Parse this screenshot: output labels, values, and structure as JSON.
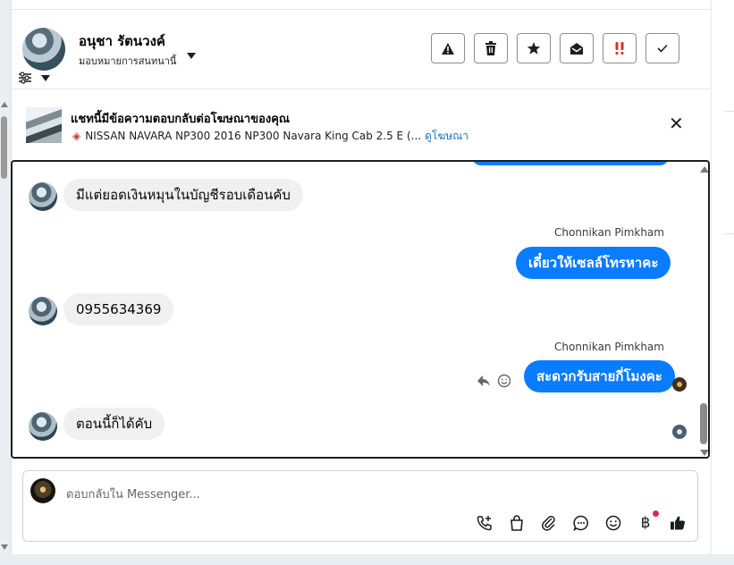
{
  "header": {
    "contact_name": "อนุชา รัตนวงค์",
    "assignment": "มอบหมายการสนทนานี้"
  },
  "actions": [
    {
      "name": "report-button",
      "icon": "warning-icon"
    },
    {
      "name": "delete-button",
      "icon": "trash-icon"
    },
    {
      "name": "star-button",
      "icon": "star-icon"
    },
    {
      "name": "mark-unread-button",
      "icon": "envelope-open-icon"
    },
    {
      "name": "priority-button",
      "icon": "double-exclamation-icon"
    },
    {
      "name": "done-button",
      "icon": "check-icon"
    }
  ],
  "ad_banner": {
    "title": "แชทนี้มีข้อความตอบกลับต่อโฆษณาของคุณ",
    "product": "NISSAN NAVARA NP300 2016 NP300 Navara King Cab 2.5 E (...",
    "view_link": "ดูโฆษณา"
  },
  "messages": [
    {
      "direction": "in",
      "text": "มีแต่ยอดเงินหมุนในบัญชีรอบเดือนคับ"
    },
    {
      "direction": "out",
      "sender": "Chonnikan Pimkham",
      "text": "เดี๋ยวให้เซลล์โทรหาคะ"
    },
    {
      "direction": "in",
      "text": "0955634369"
    },
    {
      "direction": "out",
      "sender": "Chonnikan Pimkham",
      "text": "สะดวกรับสายกี่โมงคะ"
    },
    {
      "direction": "in",
      "text": "ตอนนี้ก็ได้คับ"
    }
  ],
  "composer": {
    "placeholder": "ตอบกลับใน Messenger...",
    "tools": [
      "call-add-icon",
      "shopping-bag-icon",
      "paperclip-icon",
      "chat-bubble-icon",
      "emoji-icon",
      "baht-icon",
      "thumbs-up-icon"
    ]
  },
  "colors": {
    "outgoing_bubble": "#0a7cff",
    "incoming_bubble": "#f0f0f0",
    "link": "#1a73c8",
    "priority_red": "#e0245e"
  }
}
